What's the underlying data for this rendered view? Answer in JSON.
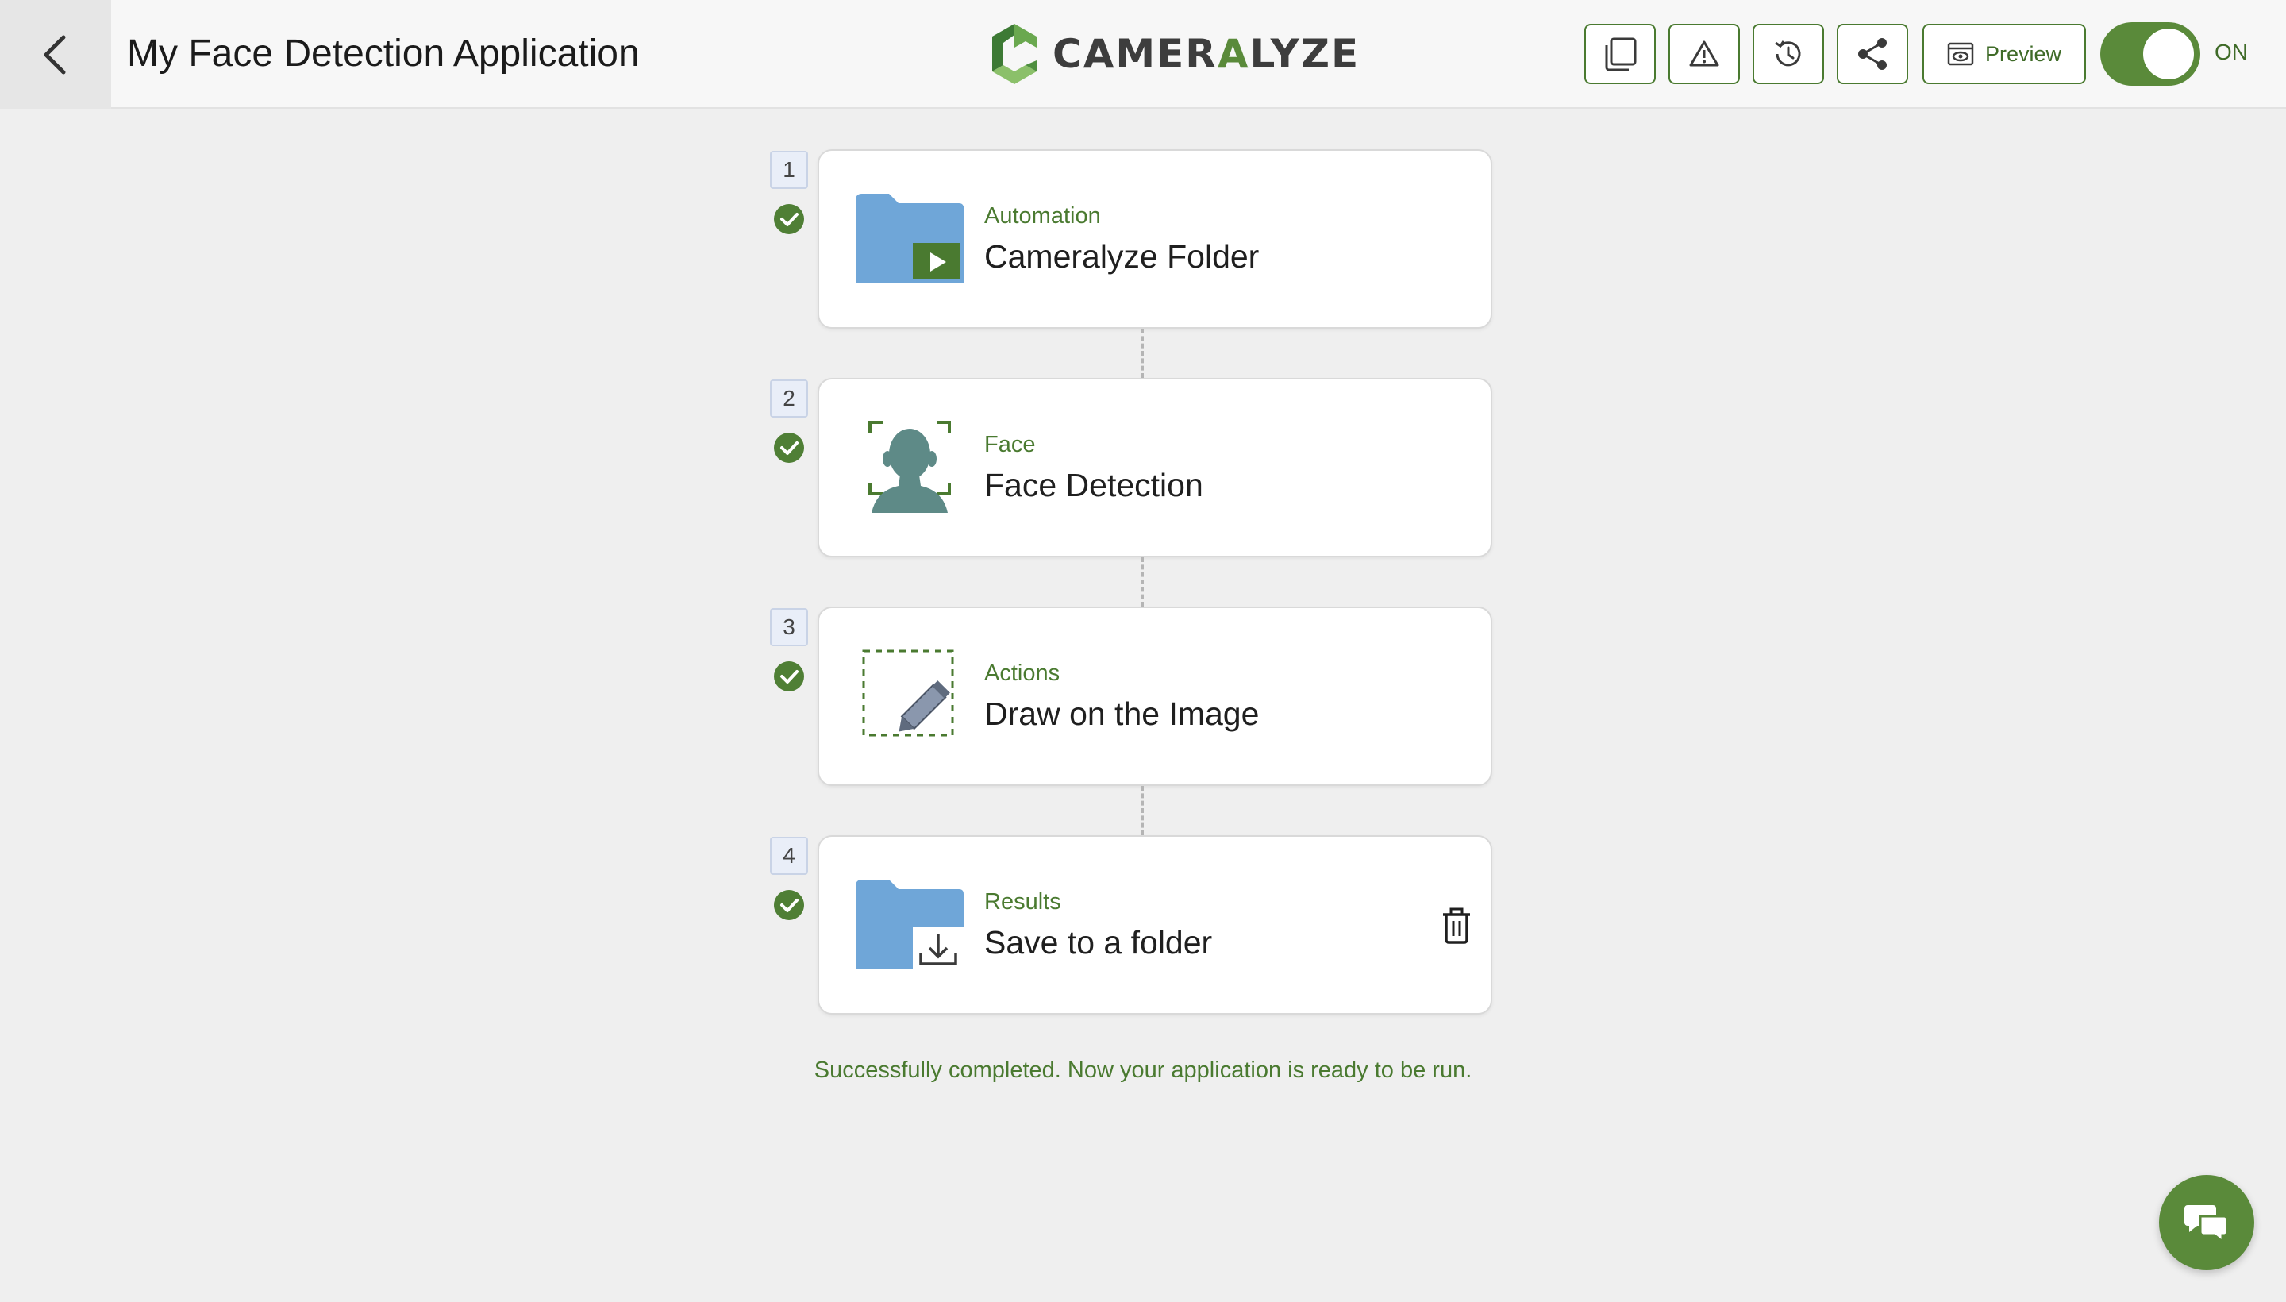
{
  "header": {
    "title": "My Face Detection Application",
    "logo_text_main": "CAMER",
    "logo_text_accent": "A",
    "logo_text_tail": "LYZE",
    "preview_label": "Preview",
    "toggle_label": "ON",
    "toggle_on": true
  },
  "steps": [
    {
      "number": "1",
      "category": "Automation",
      "name": "Cameralyze Folder",
      "icon": "folder-play-icon",
      "complete": true
    },
    {
      "number": "2",
      "category": "Face",
      "name": "Face Detection",
      "icon": "face-scan-icon",
      "complete": true
    },
    {
      "number": "3",
      "category": "Actions",
      "name": "Draw on the Image",
      "icon": "draw-pencil-icon",
      "complete": true
    },
    {
      "number": "4",
      "category": "Results",
      "name": "Save to a folder",
      "icon": "folder-download-icon",
      "complete": true
    }
  ],
  "status_message": "Successfully completed. Now your application is ready to be run.",
  "colors": {
    "accent": "#5a8a3a",
    "folder_blue": "#6fa6d8",
    "face_teal": "#5e8a87",
    "background": "#efefef"
  }
}
